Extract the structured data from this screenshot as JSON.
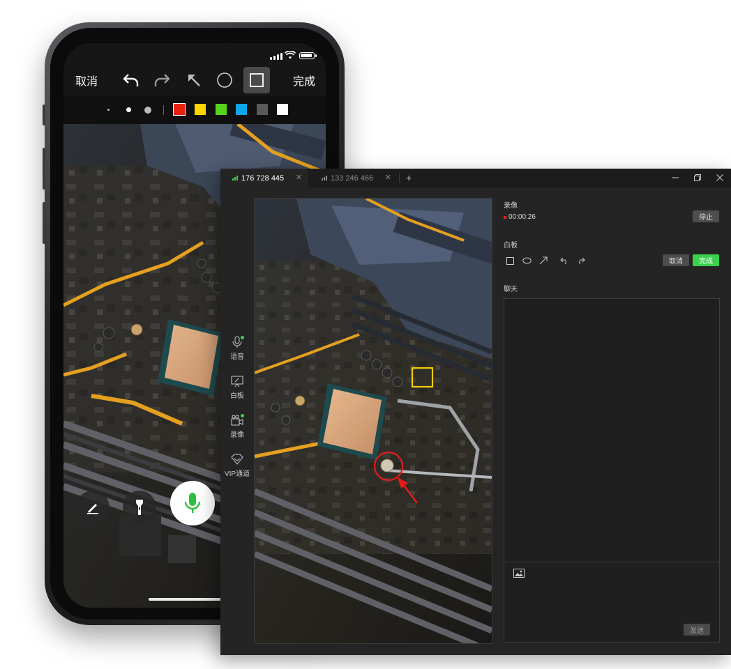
{
  "phone": {
    "toolbar": {
      "cancel_label": "取消",
      "done_label": "完成",
      "tools": [
        "undo-icon",
        "redo-icon",
        "arrow-icon",
        "circle-icon",
        "rectangle-icon"
      ],
      "active_tool": "rectangle-icon"
    },
    "brush_sizes": [
      "small",
      "medium",
      "large"
    ],
    "colors": [
      "#e8220f",
      "#ffd400",
      "#53d51b",
      "#0ea5e9",
      "#5a5a5a",
      "#ffffff"
    ],
    "selected_color": "#e8220f",
    "bottom_buttons": [
      "pen-icon",
      "flashlight-icon",
      "microphone-icon"
    ]
  },
  "window": {
    "tabs": [
      {
        "label": "176 728 445",
        "active": true
      },
      {
        "label": "133 246 466",
        "active": false
      }
    ],
    "add_tab_label": "+",
    "controls": [
      "minimize-icon",
      "restore-icon",
      "close-icon"
    ],
    "sidebar": [
      {
        "label": "语音",
        "icon": "microphone-icon",
        "online": true
      },
      {
        "label": "白板",
        "icon": "whiteboard-icon",
        "online": false
      },
      {
        "label": "录像",
        "icon": "camera-icon",
        "online": true
      },
      {
        "label": "VIP通道",
        "icon": "diamond-icon",
        "online": false
      }
    ],
    "recording": {
      "section_title": "录像",
      "timer": "00:00:26",
      "stop_label": "停止"
    },
    "whiteboard": {
      "section_title": "白板",
      "tools": [
        "rectangle-icon",
        "ellipse-icon",
        "arrow-icon",
        "undo-icon",
        "redo-icon"
      ],
      "cancel_label": "取消",
      "done_label": "完成"
    },
    "chat": {
      "section_title": "聊天",
      "send_label": "发送"
    },
    "accent": "#3bd14d"
  }
}
